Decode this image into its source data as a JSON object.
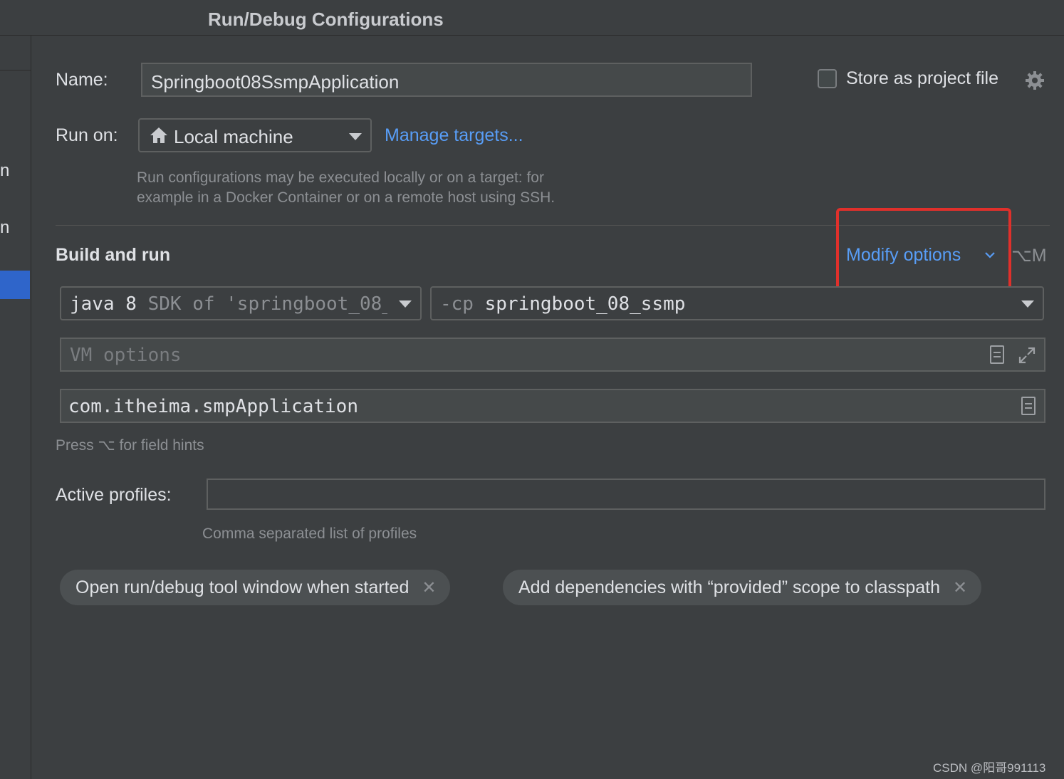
{
  "window": {
    "title": "Run/Debug Configurations"
  },
  "sidebar": {
    "fragments": [
      "n",
      "n"
    ]
  },
  "name_row": {
    "label": "Name:",
    "value": "Springboot08SsmpApplication"
  },
  "store": {
    "label": "Store as project file",
    "checked": false
  },
  "run_on": {
    "label": "Run on:",
    "value": "Local machine",
    "manage_link": "Manage targets...",
    "hint_line1": "Run configurations may be executed locally or on a target: for",
    "hint_line2": "example in a Docker Container or on a remote host using SSH."
  },
  "build_run": {
    "title": "Build and run",
    "modify_options": "Modify options",
    "modify_shortcut": "⌥M",
    "sdk_java": "java 8",
    "sdk_rest": "SDK of 'springboot_08_",
    "cp_prefix": "-cp",
    "cp_value": "springboot_08_ssmp",
    "vm_placeholder": "VM options",
    "main_class": "com.itheima.smpApplication",
    "field_hint": "Press ⌥ for field hints"
  },
  "profiles": {
    "label": "Active profiles:",
    "value": "",
    "hint": "Comma separated list of profiles"
  },
  "chips": [
    {
      "label": "Open run/debug tool window when started"
    },
    {
      "label": "Add dependencies with “provided” scope to classpath"
    }
  ],
  "watermark": "CSDN @阳哥991113",
  "colors": {
    "accent_link": "#589df6",
    "highlight_box": "#e0302b",
    "selection": "#2f65ca"
  }
}
